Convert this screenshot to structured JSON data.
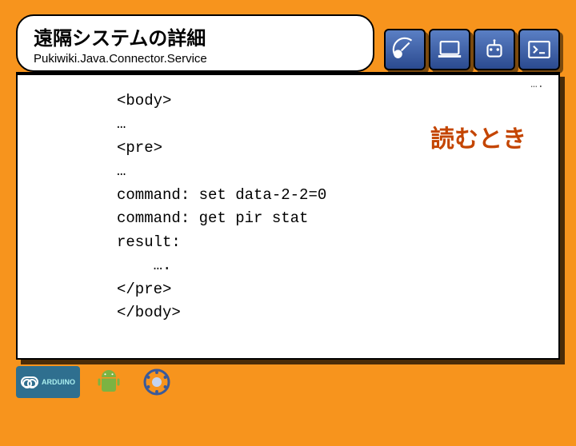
{
  "header": {
    "title": "遠隔システムの詳細",
    "subtitle": "Pukiwiki.Java.Connector.Service"
  },
  "icons": {
    "satellite": "satellite-dish",
    "computer": "laptop",
    "robot": "robot",
    "terminal": "terminal"
  },
  "main": {
    "annotation": "読むとき",
    "corner_dots": "….",
    "code_lines": [
      "<body>",
      "…",
      "<pre>",
      "…",
      "command: set data-2-2=0",
      "command: get pir stat",
      "result:",
      "    ….",
      "</pre>",
      "</body>"
    ]
  },
  "footer": {
    "arduino_label": "ARDUINO"
  }
}
